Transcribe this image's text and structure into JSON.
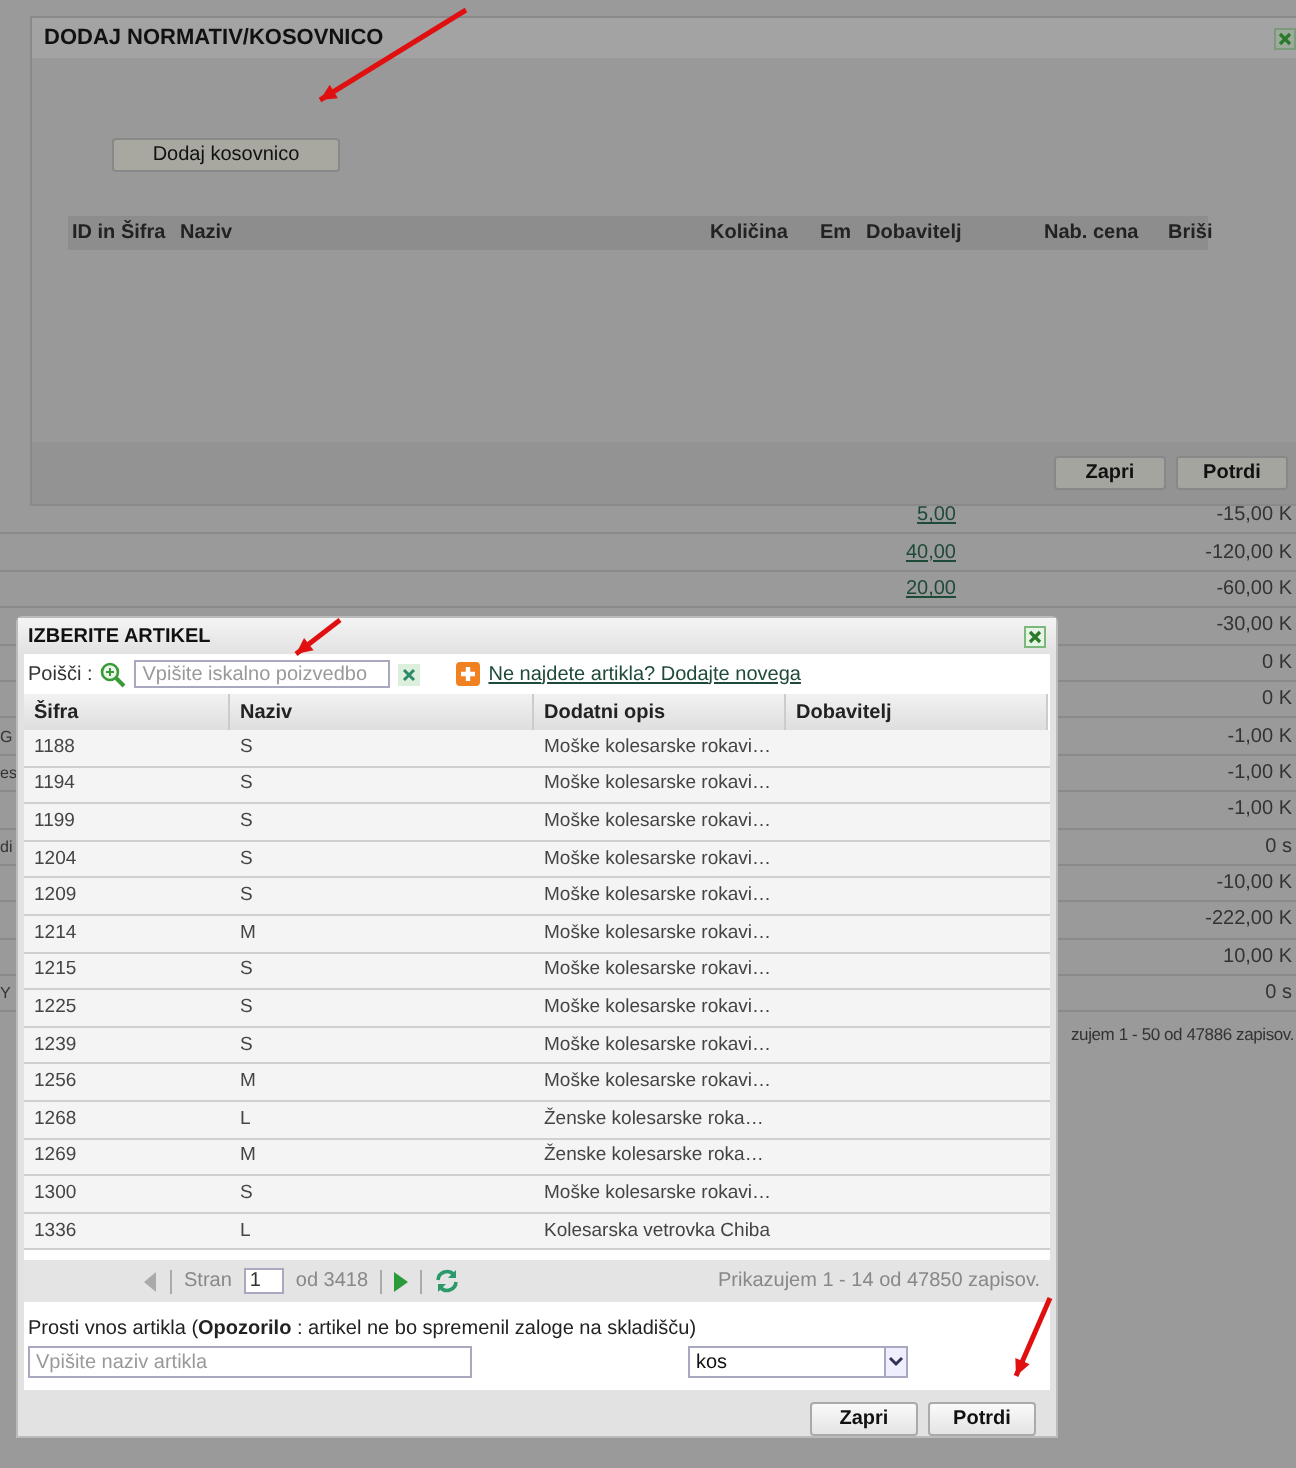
{
  "background": {
    "rows": [
      {
        "qty": "5,00",
        "amount": "-15,00 K"
      },
      {
        "qty": "40,00",
        "amount": "-120,00 K"
      },
      {
        "qty": "20,00",
        "amount": "-60,00 K"
      },
      {
        "amount": "-30,00 K"
      },
      {
        "amount": "0 K"
      },
      {
        "amount": "0 K"
      },
      {
        "label": "G",
        "amount": "-1,00 K"
      },
      {
        "label": "es",
        "amount": "-1,00 K"
      },
      {
        "amount": "-1,00 K"
      },
      {
        "label": "di",
        "amount": "0 s"
      },
      {
        "amount": "-10,00 K"
      },
      {
        "amount": "-222,00 K"
      },
      {
        "amount": "10,00 K"
      },
      {
        "label": "Y",
        "amount": "0 s"
      }
    ],
    "footer": "zujem 1 - 50 od 47886 zapisov."
  },
  "bom_dialog": {
    "title": "DODAJ NORMATIV/KOSOVNICO",
    "add_button": "Dodaj kosovnico",
    "columns": [
      "ID in Šifra",
      "Naziv",
      "Količina",
      "Em",
      "Dobavitelj",
      "Nab. cena",
      "Briši"
    ],
    "buttons": [
      "Zapri",
      "Potrdi"
    ]
  },
  "article_dialog": {
    "title": "IZBERITE ARTIKEL",
    "search": {
      "label": "Poišči :",
      "placeholder": "Vpišite iskalno poizvedbo"
    },
    "add_link": "Ne najdete artikla? Dodajte novega",
    "columns": [
      "Šifra",
      "Naziv",
      "Dodatni opis",
      "Dobavitelj"
    ],
    "rows": [
      [
        "1188",
        "S",
        "Moške kolesarske rokavi…"
      ],
      [
        "1194",
        "S",
        "Moške kolesarske rokavi…"
      ],
      [
        "1199",
        "S",
        "Moške kolesarske rokavi…"
      ],
      [
        "1204",
        "S",
        "Moške kolesarske rokavi…"
      ],
      [
        "1209",
        "S",
        "Moške kolesarske rokavi…"
      ],
      [
        "1214",
        "M",
        "Moške kolesarske rokavi…"
      ],
      [
        "1215",
        "S",
        "Moške kolesarske rokavi…"
      ],
      [
        "1225",
        "S",
        "Moške kolesarske rokavi…"
      ],
      [
        "1239",
        "S",
        "Moške kolesarske rokavi…"
      ],
      [
        "1256",
        "M",
        "Moške kolesarske rokavi…"
      ],
      [
        "1268",
        "L",
        "Ženske kolesarske roka…"
      ],
      [
        "1269",
        "M",
        "Ženske kolesarske roka…"
      ],
      [
        "1300",
        "S",
        "Moške kolesarske rokavi…"
      ],
      [
        "1336",
        "L",
        "Kolesarska vetrovka Chiba"
      ]
    ],
    "pager": {
      "page_label": "Stran",
      "page": "1",
      "total": "od 3418",
      "summary": "Prikazujem 1 - 14 od 47850 zapisov."
    },
    "simple_entry": {
      "note": "Prosti vnos artikla (**Opozorilo** : artikel ne bo spremenil zaloge na skladišču)",
      "placeholder": "Vpišite naziv artikla",
      "unit": "kos"
    },
    "buttons": [
      "Zapri",
      "Potrdi"
    ]
  }
}
